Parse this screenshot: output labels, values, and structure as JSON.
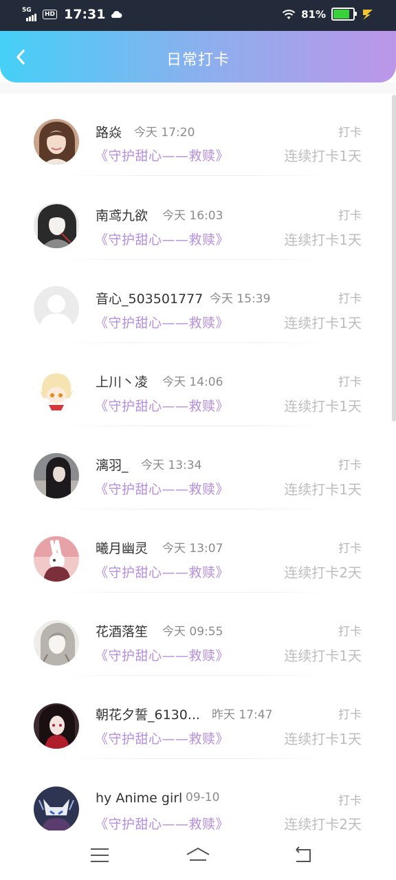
{
  "status_bar": {
    "network": "5G",
    "hd": "HD",
    "time": "17:31",
    "battery_pct": "81%",
    "icons": [
      "signal-icon",
      "cloud-icon",
      "wifi-icon",
      "battery-icon",
      "charging-icon"
    ]
  },
  "header": {
    "title": "日常打卡",
    "back_icon": "chevron-left-icon"
  },
  "colors": {
    "accent_start": "#45d0f7",
    "accent_end": "#bc96e8",
    "book_color": "#b58ee0"
  },
  "checkins": [
    {
      "name": "路焱",
      "time": "今天 17:20",
      "tag": "打卡",
      "book": "《守护甜心——救赎》",
      "streak": "连续打卡1天",
      "avatar": "girl-portrait"
    },
    {
      "name": "南鸢九欲",
      "time": "今天 16:03",
      "tag": "打卡",
      "book": "《守护甜心——救赎》",
      "streak": "连续打卡1天",
      "avatar": "ink-character"
    },
    {
      "name": "音心_503501777",
      "time": "今天 15:39",
      "tag": "打卡",
      "book": "《守护甜心——救赎》",
      "streak": "连续打卡1天",
      "avatar": "default-avatar"
    },
    {
      "name": "上川丶凌",
      "time": "今天 14:06",
      "tag": "打卡",
      "book": "《守护甜心——救赎》",
      "streak": "连续打卡1天",
      "avatar": "chibi-blonde"
    },
    {
      "name": "漓羽_",
      "time": "今天 13:34",
      "tag": "打卡",
      "book": "《守护甜心——救赎》",
      "streak": "连续打卡1天",
      "avatar": "dark-hair-girl"
    },
    {
      "name": "曦月幽灵",
      "time": "今天 13:07",
      "tag": "打卡",
      "book": "《守护甜心——救赎》",
      "streak": "连续打卡2天",
      "avatar": "bunny-figure"
    },
    {
      "name": "花酒落笙",
      "time": "今天 09:55",
      "tag": "打卡",
      "book": "《守护甜心——救赎》",
      "streak": "连续打卡1天",
      "avatar": "sketch-girl"
    },
    {
      "name": "朝花夕誓_6130...",
      "time": "昨天 17:47",
      "tag": "打卡",
      "book": "《守护甜心——救赎》",
      "streak": "连续打卡1天",
      "avatar": "red-anime-girl"
    },
    {
      "name": "hy Anime girl",
      "time": "09-10",
      "tag": "打卡",
      "book": "《守护甜心——救赎》",
      "streak": "连续打卡2天",
      "avatar": "fox-mask"
    }
  ],
  "navbar": {
    "icons": [
      "menu-icon",
      "home-icon",
      "back-icon"
    ]
  }
}
